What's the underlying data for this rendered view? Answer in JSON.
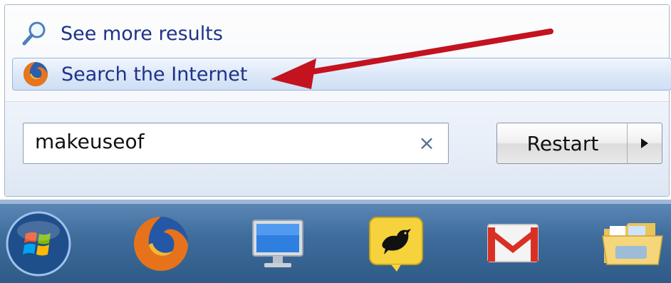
{
  "results": {
    "see_more_label": "See more results",
    "search_internet_label": "Search the Internet"
  },
  "search": {
    "value": "makeuseof",
    "clear_glyph": "×"
  },
  "power": {
    "restart_label": "Restart",
    "options_glyph": "▶"
  },
  "taskbar": {
    "icons": [
      "start-orb-icon",
      "firefox-icon",
      "computer-monitor-icon",
      "twitter-bird-icon",
      "gmail-icon",
      "folder-icon"
    ]
  },
  "colors": {
    "accent_text": "#1e3287",
    "annotation_arrow": "#c4121f",
    "taskbar": "#3f6d9c"
  }
}
